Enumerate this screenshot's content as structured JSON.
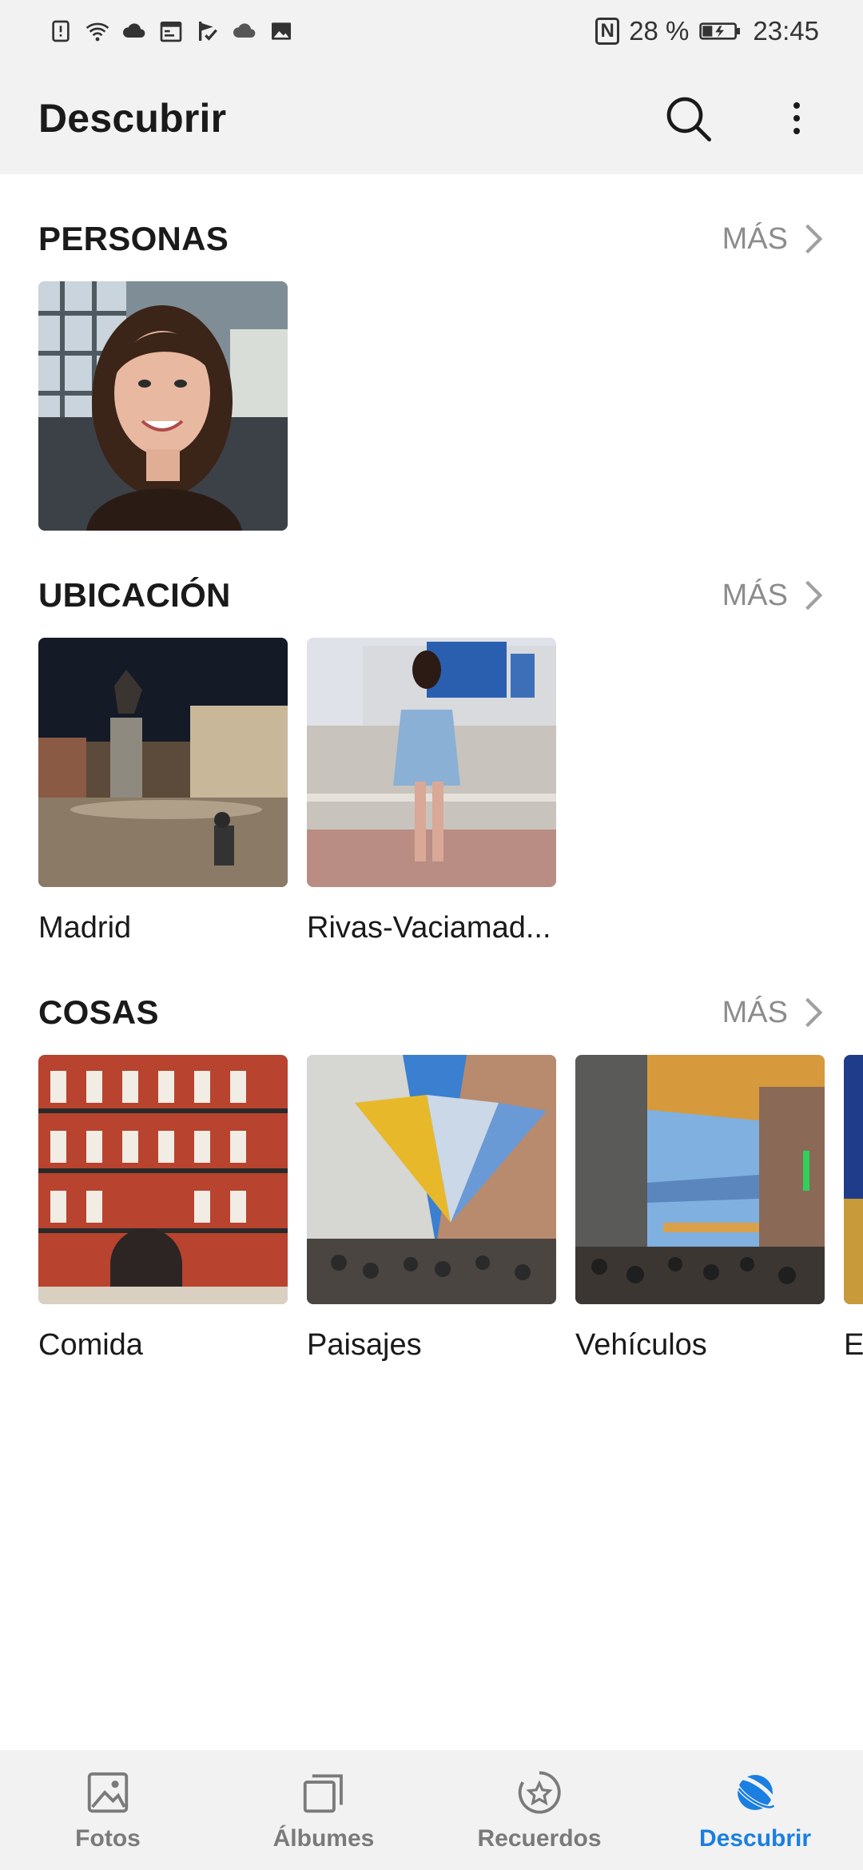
{
  "status": {
    "nfc": "N",
    "battery_percent": "28 %",
    "time": "23:45",
    "left_icons": [
      "sim-alert-icon",
      "wifi-icon",
      "cloud-icon",
      "calendar-icon",
      "check-flag-icon",
      "cloud-sync-icon",
      "image-icon"
    ]
  },
  "appbar": {
    "title": "Descubrir",
    "icons": [
      "search-icon",
      "more-vert-icon"
    ]
  },
  "sections": {
    "personas": {
      "title": "PERSONAS",
      "more": "MÁS"
    },
    "ubicacion": {
      "title": "UBICACIÓN",
      "more": "MÁS",
      "items": [
        {
          "label": "Madrid"
        },
        {
          "label": "Rivas-Vaciamad..."
        }
      ]
    },
    "cosas": {
      "title": "COSAS",
      "more": "MÁS",
      "items": [
        {
          "label": "Comida"
        },
        {
          "label": "Paisajes"
        },
        {
          "label": "Vehículos"
        },
        {
          "label": "E"
        }
      ]
    }
  },
  "nav": {
    "items": [
      {
        "label": "Fotos",
        "icon": "photo-icon",
        "active": false
      },
      {
        "label": "Álbumes",
        "icon": "albums-icon",
        "active": false
      },
      {
        "label": "Recuerdos",
        "icon": "memories-icon",
        "active": false
      },
      {
        "label": "Descubrir",
        "icon": "discover-icon",
        "active": true
      }
    ]
  },
  "colors": {
    "accent": "#1a7fe0",
    "bar_bg": "#f2f2f2",
    "muted": "#8c8c8c"
  }
}
